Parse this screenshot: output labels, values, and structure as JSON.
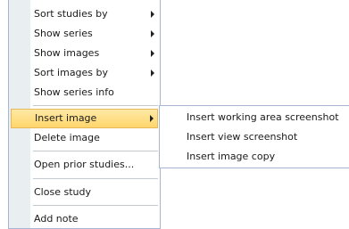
{
  "context_menu": {
    "items": [
      {
        "label": "Sort studies by"
      },
      {
        "label": "Show series"
      },
      {
        "label": "Show images"
      },
      {
        "label": "Sort images by"
      },
      {
        "label": "Show series info"
      },
      {
        "label": "Insert image"
      },
      {
        "label": "Delete image"
      },
      {
        "label": "Open prior studies..."
      },
      {
        "label": "Close study"
      },
      {
        "label": "Add note"
      }
    ]
  },
  "submenu": {
    "items": [
      {
        "label": "Insert working area screenshot"
      },
      {
        "label": "Insert view screenshot"
      },
      {
        "label": "Insert image copy"
      }
    ]
  },
  "colors": {
    "highlight": "#ffd66b",
    "gutter": "#e9eef1",
    "border": "#a7b7d3"
  }
}
